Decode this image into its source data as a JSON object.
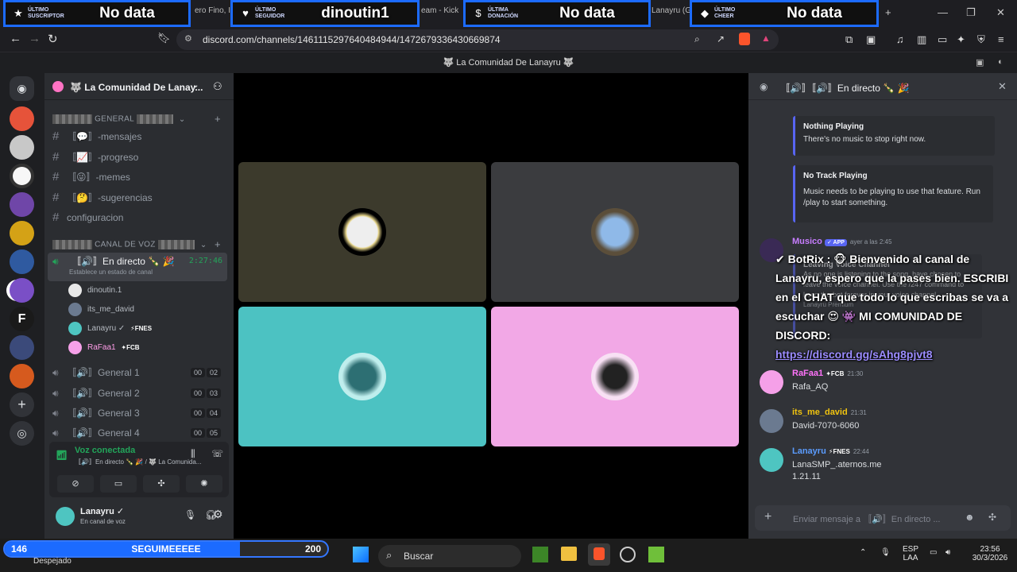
{
  "browser": {
    "overlay_widgets": [
      {
        "small": "ÚLTIMO SUSCRIPTOR",
        "big": "No data",
        "icon": "star-icon"
      },
      {
        "small": "ÚLTIMO SEGUIDOR",
        "big": "dinoutin1",
        "icon": "heart-icon"
      },
      {
        "small": "ÚLTIMA DONACIÓN",
        "big": "No data",
        "icon": "dollar-icon"
      },
      {
        "small": "ÚLTIMO CHEER",
        "big": "No data",
        "icon": "diamond-icon"
      }
    ],
    "tab_fragments": [
      "ero Fino, I",
      "eam - Kick",
      "Lanayru (G"
    ],
    "url": "discord.com/channels/1461115297640484944/1472679336430669874"
  },
  "discord": {
    "window_title": "🐺 La Comunidad De Lanayru 🐺",
    "server_name": "🐺 La Comunidad De Lanay...",
    "categories": {
      "general": "GENERAL",
      "voice": "CANAL DE VOZ"
    },
    "text_channels": [
      {
        "name": "-mensajes",
        "emoji": "💬"
      },
      {
        "name": "-progreso",
        "emoji": "📈"
      },
      {
        "name": "-memes",
        "emoji": "😜"
      },
      {
        "name": "-sugerencias",
        "emoji": "🤔"
      }
    ],
    "forum_channel": "configuracion",
    "active_voice": {
      "name": "En directo 🍾 🎉",
      "timer": "2:27:46",
      "status": "Establece un estado de canal"
    },
    "voice_users": [
      {
        "name": "dinoutin.1",
        "tag": ""
      },
      {
        "name": "its_me_david",
        "tag": ""
      },
      {
        "name": "Lanayru ✓",
        "tag": "⚡FNES"
      },
      {
        "name": "RaFaa1",
        "tag": "✦FCB"
      }
    ],
    "other_voice": [
      {
        "name": "General 1",
        "count": [
          "00",
          "02"
        ]
      },
      {
        "name": "General 2",
        "count": [
          "00",
          "03"
        ]
      },
      {
        "name": "General 3",
        "count": [
          "00",
          "04"
        ]
      },
      {
        "name": "General 4",
        "count": [
          "00",
          "05"
        ]
      }
    ],
    "voice_panel": {
      "title": "Voz conectada",
      "subtitle": "〚🔊〛En directo 🍾 🎉 / 🐺 La Comunida..."
    },
    "user_panel": {
      "name": "Lanayru ✓",
      "status": "En canal de voz"
    },
    "chat": {
      "header": "〚🔊〛En directo 🍾 🎉",
      "embeds": [
        {
          "title": "Nothing Playing",
          "text": "There's no music to stop right now."
        },
        {
          "title": "No Track Playing",
          "text": "Music needs to be playing to use that feature. Run /play to start something."
        }
      ],
      "bot": {
        "name": "Musico",
        "badge": "✓ APP",
        "time": "ayer a las 2:45",
        "embed_title": "Leaving Voice Channel",
        "embed_text": "As no one is listening to the song, have chosen to leave the voice channel. Use the /247 command to keep the bot forever in your voice channel.",
        "footer": "Lanayru Premium"
      },
      "overlay_text": "✔ BotRix : 🐵 Bienvenido al canal de Lanayru, espero que la pases bien. ESCRIBI en el CHAT que todo lo que escribas se va a escuchar 😍 👾 MI COMUNIDAD DE DISCORD:",
      "overlay_link": "https://discord.gg/sAhg8pjvt8",
      "messages": [
        {
          "name": "RaFaa1",
          "tag": "✦FCB",
          "time": "21:30",
          "text": "Rafa_AQ",
          "color": "#ff73fa"
        },
        {
          "name": "its_me_david",
          "tag": "",
          "time": "21:31",
          "text": "David-7070-6060",
          "color": "#f1c40f"
        },
        {
          "name": "Lanayru",
          "tag": "⚡FNES",
          "time": "22:44",
          "text": "LanaSMP_.aternos.me",
          "text2": "1.21.11",
          "color": "#5b9cff"
        }
      ],
      "composer_placeholder": "Enviar mensaje a 〚🔊〛En directo ..."
    }
  },
  "taskbar": {
    "follow_goal": {
      "current": "146",
      "label": "SEGUIMEEEEE",
      "target": "200",
      "fraction": 0.73
    },
    "weather": "Despejado",
    "search_placeholder": "Buscar",
    "lang": "ESP",
    "lang2": "LAA",
    "time": "23:56",
    "date": "30/3/2026"
  },
  "colors": {
    "accent": "#1c6bff",
    "discord_blurple": "#5865f2",
    "online": "#23a55a"
  }
}
